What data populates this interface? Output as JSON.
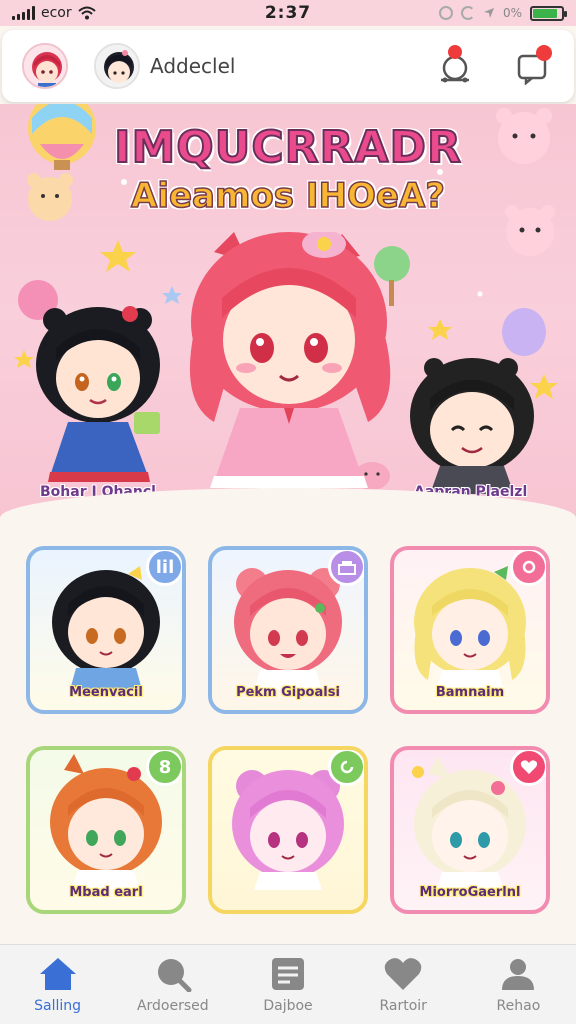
{
  "status_bar": {
    "carrier": "ecor",
    "time": "2:37",
    "right_text": "0%"
  },
  "header": {
    "title": "Addeclel"
  },
  "hero": {
    "title": "IMQUCRRADR",
    "subtitle": "Aieamos IHOeA?",
    "left_label": "Bohar I Ohancl",
    "right_label": "Aapran Plaelzl"
  },
  "cards": [
    {
      "name": "Meenvacil",
      "badge": "lil",
      "border_color": "#8db7e6",
      "badge_color": "#7fa8e8"
    },
    {
      "name": "Pekm Gipoalsi",
      "badge": "",
      "border_color": "#8db7e6",
      "badge_color": "#b98ee6"
    },
    {
      "name": "Bamnaim",
      "badge": "",
      "border_color": "#f28bb0",
      "badge_color": "#f26e96"
    },
    {
      "name": "Mbad earl",
      "badge": "8",
      "border_color": "#a8d67a",
      "badge_color": "#7cc95d"
    },
    {
      "name": "",
      "badge": "",
      "border_color": "#f5d660",
      "badge_color": "#7cc95d"
    },
    {
      "name": "MiorroGaerlnl",
      "badge": "",
      "border_color": "#f28bb0",
      "badge_color": "#f04a73"
    }
  ],
  "nav": [
    {
      "label": "Salling",
      "icon": "home-icon"
    },
    {
      "label": "Ardoersed",
      "icon": "search-icon"
    },
    {
      "label": "Dajboe",
      "icon": "list-icon"
    },
    {
      "label": "Rartoir",
      "icon": "heart-icon"
    },
    {
      "label": "Rehao",
      "icon": "people-icon"
    }
  ],
  "colors": {
    "accent": "#3a6fd6",
    "hero_pink": "#f7c6d3",
    "title_pink": "#e94b8d",
    "subtitle_yellow": "#f7b733"
  }
}
